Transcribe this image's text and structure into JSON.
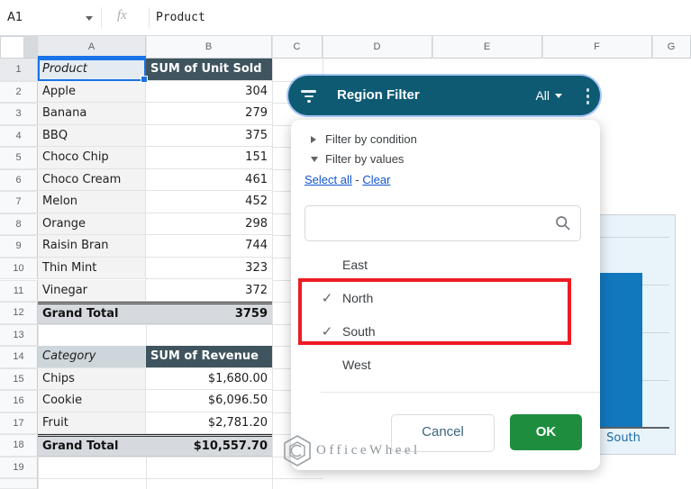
{
  "colors": {
    "pill-teal": "#0e5a73",
    "dark-header": "#3f545e",
    "ok-green": "#1e8e3e",
    "annotation-red": "#ed1c24",
    "link-blue": "#1155cc",
    "bar-blue": "#1278bd",
    "selection-blue": "#1a73e8"
  },
  "formula_bar": {
    "cell_ref": "A1",
    "fx_label": "fx",
    "value": "Product"
  },
  "grid": {
    "col_headers": [
      "A",
      "B",
      "C",
      "D",
      "E",
      "F",
      "G"
    ],
    "row_count": 19
  },
  "pivot_unit_sold": {
    "header": {
      "col1": "Product",
      "col2": "SUM of Unit Sold"
    },
    "rows": [
      [
        "Apple",
        "304"
      ],
      [
        "Banana",
        "279"
      ],
      [
        "BBQ",
        "375"
      ],
      [
        "Choco Chip",
        "151"
      ],
      [
        "Choco Cream",
        "461"
      ],
      [
        "Melon",
        "452"
      ],
      [
        "Orange",
        "298"
      ],
      [
        "Raisin Bran",
        "744"
      ],
      [
        "Thin Mint",
        "323"
      ],
      [
        "Vinegar",
        "372"
      ]
    ],
    "total": [
      "Grand Total",
      "3759"
    ]
  },
  "pivot_revenue": {
    "header": {
      "col1": "Category",
      "col2": "SUM of Revenue"
    },
    "rows": [
      [
        "Chips",
        "$1,680.00"
      ],
      [
        "Cookie",
        "$6,096.50"
      ],
      [
        "Fruit",
        "$2,781.20"
      ]
    ],
    "total": [
      "Grand Total",
      "$10,557.70"
    ]
  },
  "filter_popup": {
    "title": "Region Filter",
    "scope_value": "All",
    "condition_label": "Filter by condition",
    "values_label": "Filter by values",
    "select_all_label": "Select all",
    "link_separator": "-",
    "clear_label": "Clear",
    "search_placeholder": "",
    "values": [
      {
        "label": "East",
        "checked": false
      },
      {
        "label": "North",
        "checked": true
      },
      {
        "label": "South",
        "checked": true
      },
      {
        "label": "West",
        "checked": false
      }
    ],
    "cancel_label": "Cancel",
    "ok_label": "OK"
  },
  "chart": {
    "visible_bar_category": "South"
  },
  "watermark": {
    "text": "OfficeWheel"
  }
}
